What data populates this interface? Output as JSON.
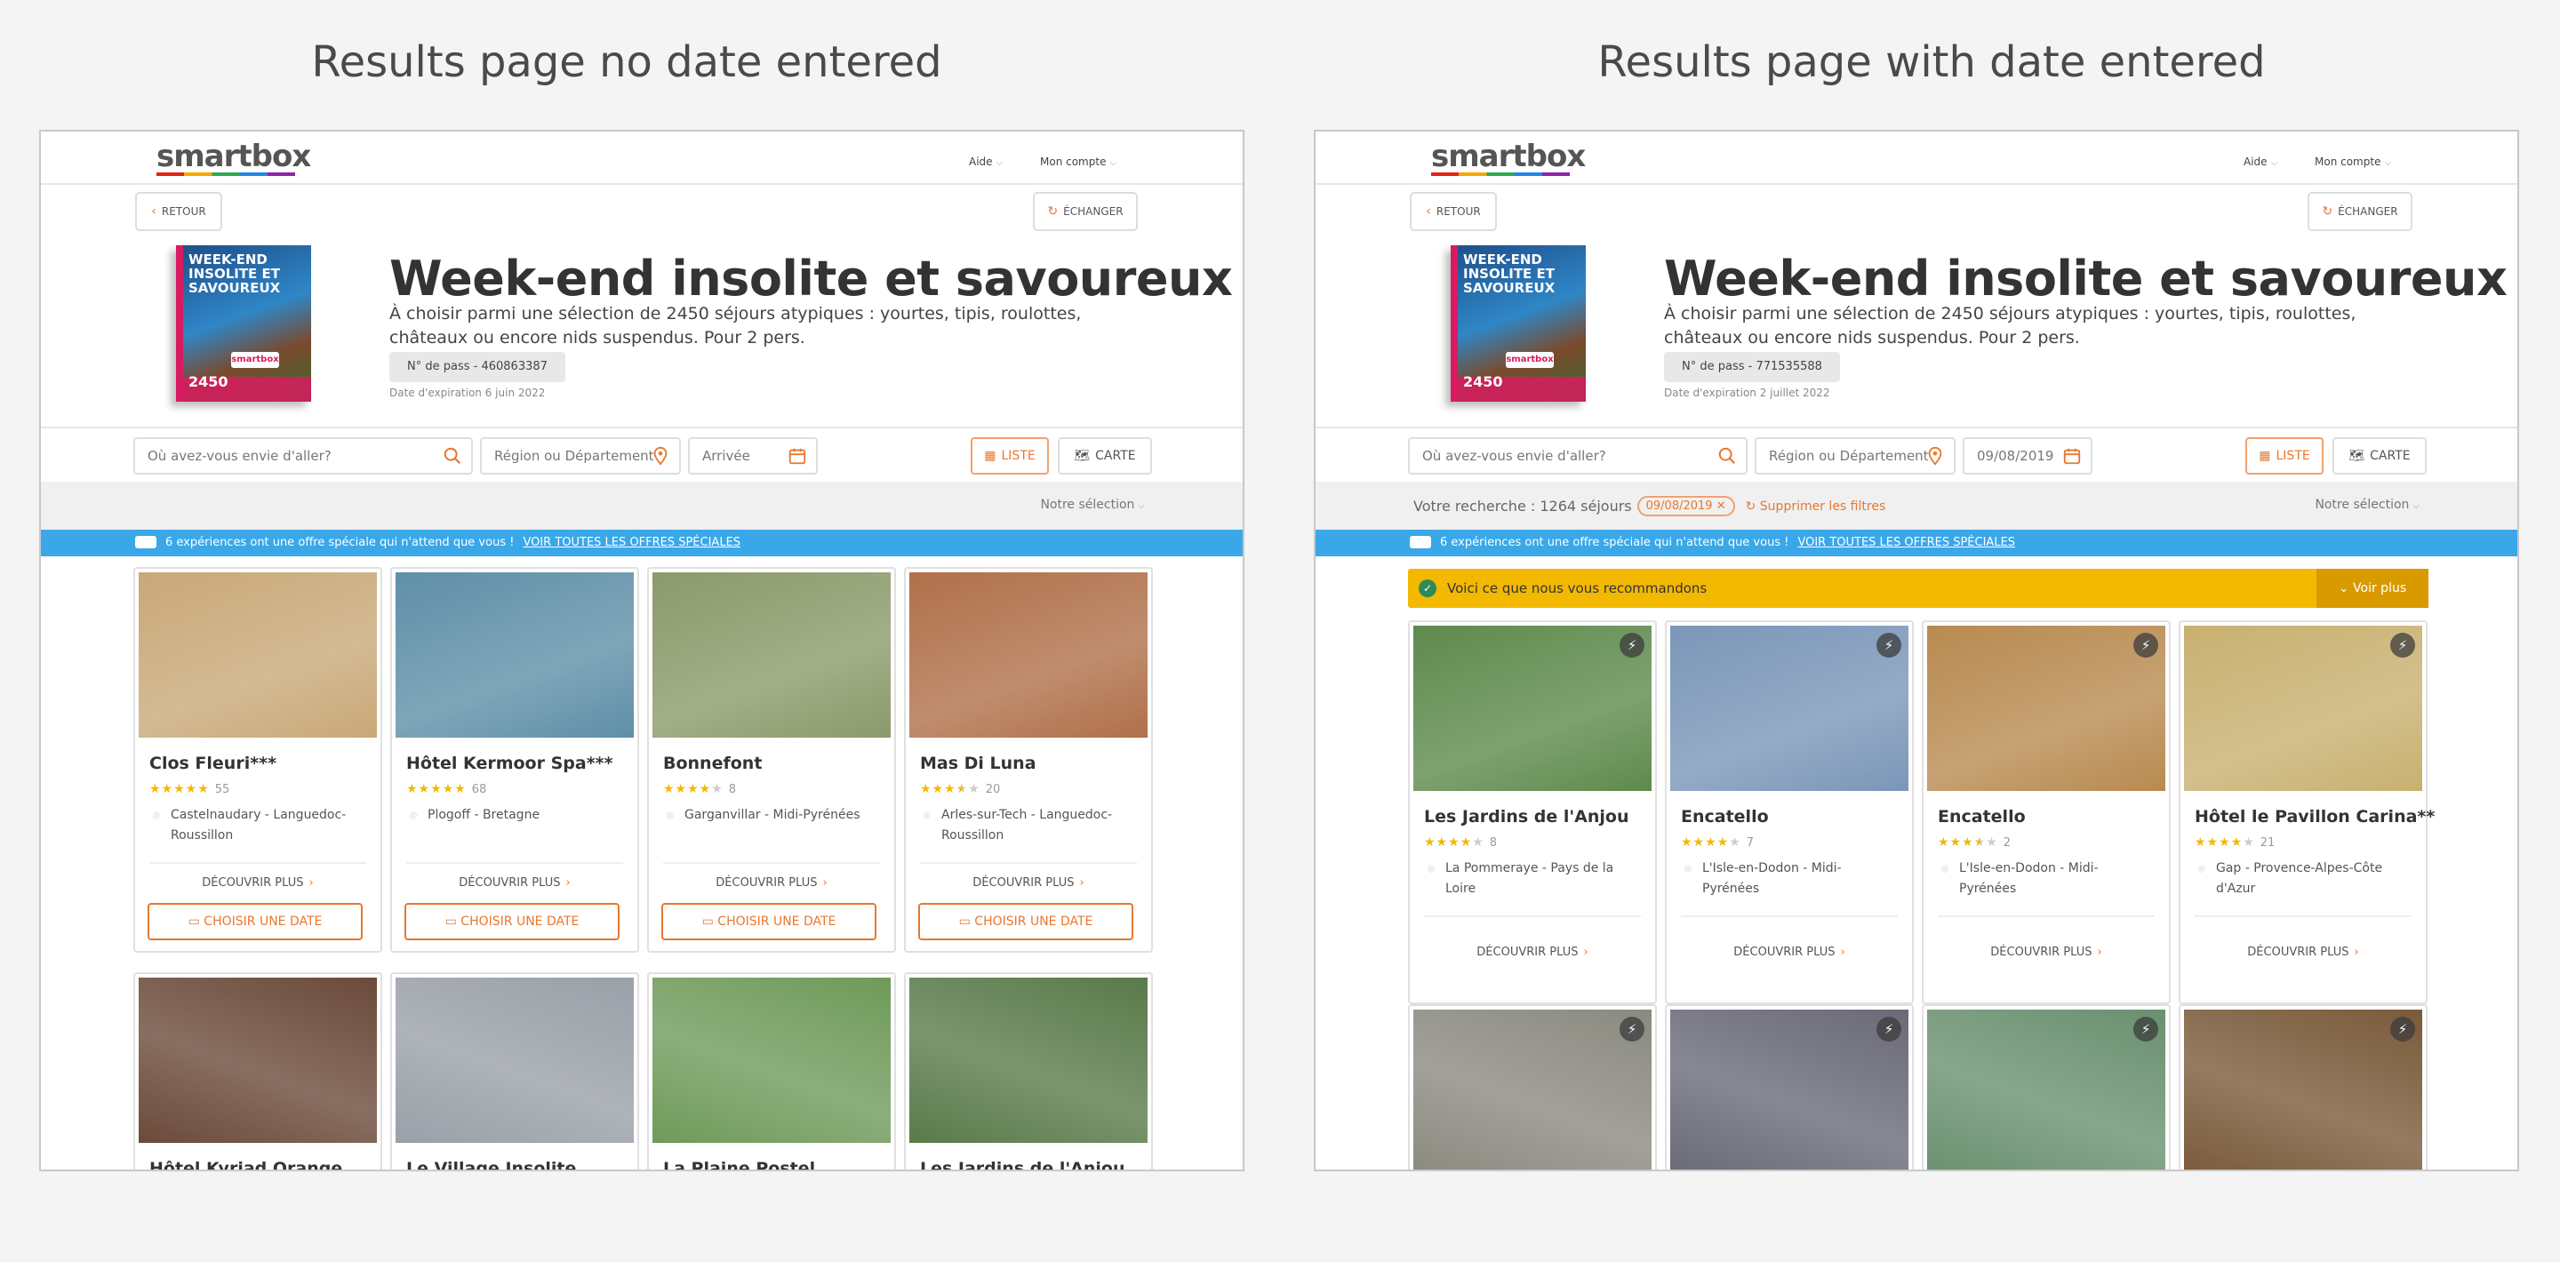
{
  "headings": {
    "left": "Results page no date entered",
    "right": "Results page with date entered"
  },
  "colors": {
    "accent": "#e8772e",
    "promo_blue": "#3aa7e9",
    "recommend_yellow": "#f3b800",
    "star": "#f3b800"
  },
  "common": {
    "logo": "smartbox",
    "aide": "Aide",
    "mon_compte": "Mon compte",
    "retour": "RETOUR",
    "echanger": "ÉCHANGER",
    "box_art_title": "WEEK-END INSOLITE ET SAVOUREUX",
    "box_art_brand": "smartbox",
    "box_art_count": "2450",
    "title": "Week-end insolite et savoureux",
    "description": "À choisir parmi une sélection de 2450 séjours atypiques : yourtes, tipis, roulottes, châteaux ou encore nids suspendus. Pour 2 pers.",
    "search_placeholder": "Où avez-vous envie d'aller?",
    "region_placeholder": "Région ou Département",
    "arrival_placeholder": "Arrivée",
    "liste": "LISTE",
    "carte": "CARTE",
    "sort": "Notre sélection",
    "promo_text": "6 expériences ont une offre spéciale qui n'attend que vous !",
    "promo_link": "VOIR TOUTES LES OFFRES SPÉCIALES",
    "decouvrir": "DÉCOUVRIR PLUS",
    "choisir": "CHOISIR UNE DATE"
  },
  "left": {
    "pass": "N° de pass - 460863387",
    "expiry": "Date d'expiration 6 juin 2022",
    "cards": [
      {
        "name": "Clos Fleuri***",
        "rating": 5,
        "count": "55",
        "loc1": "Castelnaudary - Languedoc-",
        "loc2": "Roussillon",
        "img": "#c9a878"
      },
      {
        "name": "Hôtel Kermoor Spa***",
        "rating": 5,
        "count": "68",
        "loc1": "Plogoff - Bretagne",
        "loc2": "",
        "img": "#5f8fa8"
      },
      {
        "name": "Bonnefont",
        "rating": 4,
        "count": "8",
        "loc1": "Garganvillar - Midi-Pyrénées",
        "loc2": "",
        "img": "#8a9a6a"
      },
      {
        "name": "Mas Di Luna",
        "rating": 3.5,
        "count": "20",
        "loc1": "Arles-sur-Tech - Languedoc-",
        "loc2": "Roussillon",
        "img": "#b0704a"
      }
    ],
    "row2": [
      {
        "name": "Hôtel Kyriad Orange",
        "img": "#6b4a3a"
      },
      {
        "name": "Le Village Insolite",
        "img": "#9aa0a8"
      },
      {
        "name": "La Plaine Postel",
        "img": "#6f9a5a"
      },
      {
        "name": "Les Jardins de l'Anjou",
        "img": "#5a7a4a"
      }
    ]
  },
  "right": {
    "pass": "N° de pass - 771535588",
    "expiry": "Date d'expiration 2 juillet 2022",
    "arrival_value": "09/08/2019",
    "recherche": "Votre recherche : 1264 séjours",
    "chip": "09/08/2019",
    "clear": "Supprimer les filtres",
    "recommend": "Voici ce que nous vous recommandons",
    "voir_plus": "Voir plus",
    "cards": [
      {
        "name": "Les Jardins de l'Anjou",
        "rating": 4,
        "count": "8",
        "loc1": "La Pommeraye - Pays de la",
        "loc2": "Loire",
        "img": "#5e8a4c"
      },
      {
        "name": "Encatello",
        "rating": 4,
        "count": "7",
        "loc1": "L'Isle-en-Dodon - Midi-",
        "loc2": "Pyrénées",
        "img": "#7a96b8"
      },
      {
        "name": "Encatello",
        "rating": 3.5,
        "count": "2",
        "loc1": "L'Isle-en-Dodon - Midi-",
        "loc2": "Pyrénées",
        "img": "#b88a50"
      },
      {
        "name": "Hôtel le Pavillon Carina**",
        "rating": 4,
        "count": "21",
        "loc1": "Gap - Provence-Alpes-Côte",
        "loc2": "d'Azur",
        "img": "#c8b070"
      }
    ],
    "row2": [
      {
        "img": "#8a8a80"
      },
      {
        "img": "#6a6a78"
      },
      {
        "img": "#6a9070"
      },
      {
        "img": "#7a5a3a"
      }
    ]
  }
}
